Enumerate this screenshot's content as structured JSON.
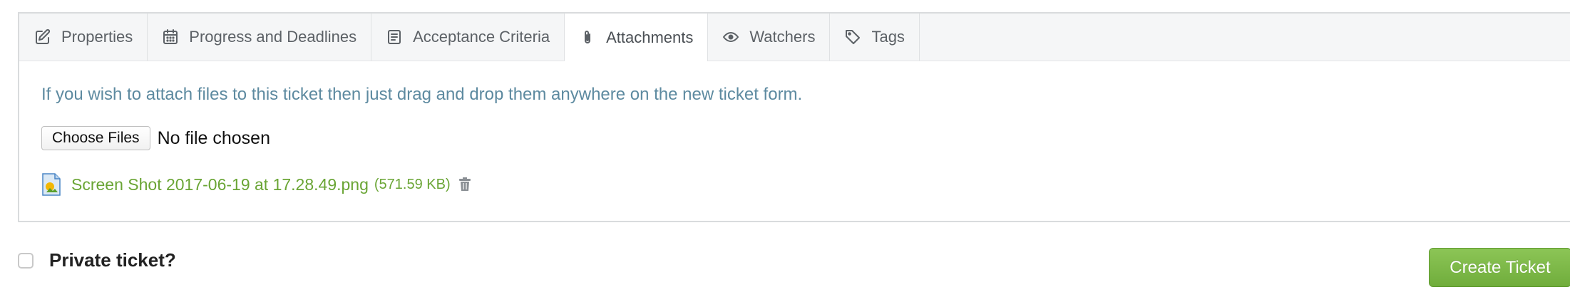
{
  "tabs": [
    {
      "label": "Properties",
      "icon": "edit-icon"
    },
    {
      "label": "Progress and Deadlines",
      "icon": "calendar-icon"
    },
    {
      "label": "Acceptance Criteria",
      "icon": "document-icon"
    },
    {
      "label": "Attachments",
      "icon": "paperclip-icon",
      "active": true
    },
    {
      "label": "Watchers",
      "icon": "eye-icon"
    },
    {
      "label": "Tags",
      "icon": "tag-icon"
    }
  ],
  "attachments": {
    "hint": "If you wish to attach files to this ticket then just drag and drop them anywhere on the new ticket form.",
    "choose_label": "Choose Files",
    "no_file_text": "No file chosen",
    "file": {
      "name": "Screen Shot 2017-06-19 at 17.28.49.png",
      "size": "(571.59 KB)",
      "icon": "image-file-icon"
    }
  },
  "private": {
    "label": "Private ticket?",
    "checked": false
  },
  "submit_label": "Create Ticket",
  "colors": {
    "link_green": "#6aa535",
    "hint_blue": "#5d8aa0",
    "button_green": "#7ab648"
  }
}
